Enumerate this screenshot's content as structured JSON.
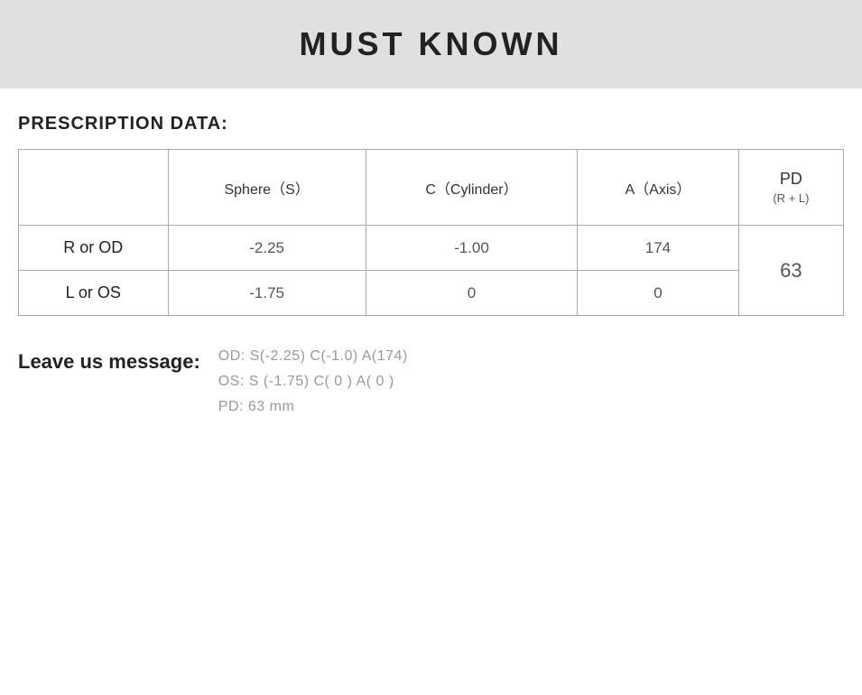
{
  "header": {
    "title": "MUST KNOWN"
  },
  "prescription_section": {
    "label": "PRESCRIPTION DATA:",
    "table": {
      "headers": [
        {
          "id": "eye",
          "label": ""
        },
        {
          "id": "sphere",
          "label": "Sphere（S）"
        },
        {
          "id": "cylinder",
          "label": "C（Cylinder）"
        },
        {
          "id": "axis",
          "label": "A（Axis）"
        },
        {
          "id": "pd",
          "label_main": "PD",
          "label_sub": "(R + L)"
        }
      ],
      "rows": [
        {
          "label": "R or OD",
          "sphere": "-2.25",
          "cylinder": "-1.00",
          "axis": "174",
          "pd": "63"
        },
        {
          "label": "L or OS",
          "sphere": "-1.75",
          "cylinder": "0",
          "axis": "0",
          "pd": ""
        }
      ]
    }
  },
  "leave_message": {
    "label": "Leave us message:",
    "lines": [
      "OD:  S(-2.25)    C(-1.0)    A(174)",
      "OS:  S (-1.75)    C( 0 )    A( 0 )",
      "PD:  63 mm"
    ]
  }
}
